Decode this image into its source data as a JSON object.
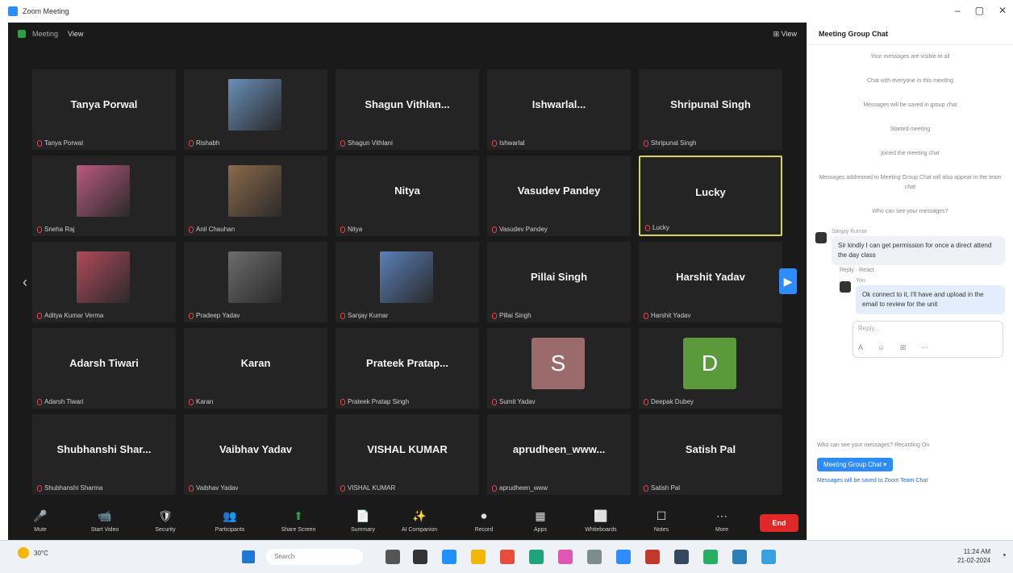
{
  "window": {
    "title": "Zoom Meeting",
    "controls": [
      "–",
      "▢",
      "✕"
    ]
  },
  "meeting_top": {
    "info": "View",
    "stat": "Meeting",
    "view_label": "⊞ View"
  },
  "tiles": [
    {
      "name": "Tanya Porwal",
      "label": "Tanya Porwal",
      "type": "name"
    },
    {
      "name": "",
      "label": "Rishabh",
      "type": "photo",
      "color": "#6a8fb8"
    },
    {
      "name": "Shagun Vithlan...",
      "label": "Shagun Vithlani",
      "type": "name"
    },
    {
      "name": "Ishwarlal...",
      "label": "Ishwarlal",
      "type": "name"
    },
    {
      "name": "Shripunal Singh",
      "label": "Shripunal Singh",
      "type": "name"
    },
    {
      "name": "",
      "label": "Sneha Raj",
      "type": "photo",
      "color": "#b95a7e"
    },
    {
      "name": "",
      "label": "Anil Chauhan",
      "type": "photo",
      "color": "#8a6a4a"
    },
    {
      "name": "Nitya",
      "label": "Nitya",
      "type": "name"
    },
    {
      "name": "Vasudev Pandey",
      "label": "Vasudev Pandey",
      "type": "name"
    },
    {
      "name": "Lucky",
      "label": "Lucky",
      "type": "name",
      "active": true
    },
    {
      "name": "",
      "label": "Aditya Kumar Verma",
      "type": "photo",
      "color": "#b04a5a"
    },
    {
      "name": "",
      "label": "Pradeep Yadav",
      "type": "photo",
      "color": "#6c6c6c"
    },
    {
      "name": "",
      "label": "Sanjay Kumar",
      "type": "photo",
      "color": "#5a7fb8"
    },
    {
      "name": "Pillai Singh",
      "label": "Pillai Singh",
      "type": "name"
    },
    {
      "name": "Harshit Yadav",
      "label": "Harshit Yadav",
      "type": "name"
    },
    {
      "name": "Adarsh Tiwari",
      "label": "Adarsh Tiwari",
      "type": "name"
    },
    {
      "name": "Karan",
      "label": "Karan",
      "type": "name"
    },
    {
      "name": "Prateek Pratap...",
      "label": "Prateek Pratap Singh",
      "type": "name"
    },
    {
      "name": "",
      "label": "Sumit Yadav",
      "type": "letter",
      "letter": "S",
      "color": "#9b6b6b"
    },
    {
      "name": "",
      "label": "Deepak Dubey",
      "type": "letter",
      "letter": "D",
      "color": "#5a9a3a"
    },
    {
      "name": "Shubhanshi Shar...",
      "label": "Shubhanshi Sharma",
      "type": "name"
    },
    {
      "name": "Vaibhav Yadav",
      "label": "Vaibhav Yadav",
      "type": "name"
    },
    {
      "name": "VISHAL KUMAR",
      "label": "VISHAL KUMAR",
      "type": "name"
    },
    {
      "name": "aprudheen_www...",
      "label": "aprudheen_www",
      "type": "name"
    },
    {
      "name": "Satish Pal",
      "label": "Satish Pal",
      "type": "name"
    }
  ],
  "toolbar": [
    {
      "icon": "🎤",
      "label": "Mute"
    },
    {
      "icon": "📹",
      "label": "Start Video"
    },
    {
      "icon": "🛡",
      "label": "Security"
    },
    {
      "icon": "👥",
      "label": "Participants"
    },
    {
      "icon": "⬆",
      "label": "Share Screen",
      "green": true
    },
    {
      "icon": "📄",
      "label": "Summary"
    },
    {
      "icon": "✨",
      "label": "AI Companion"
    },
    {
      "icon": "⏺",
      "label": "Record"
    },
    {
      "icon": "▦",
      "label": "Apps"
    },
    {
      "icon": "⬜",
      "label": "Whiteboards"
    },
    {
      "icon": "☐",
      "label": "Notes"
    },
    {
      "icon": "⋯",
      "label": "More"
    }
  ],
  "end_label": "End",
  "panel": {
    "title": "Meeting Group Chat",
    "system_messages": [
      "Your messages are visible to all",
      "Chat with everyone in this meeting",
      "Messages will be saved in group chat",
      "Started meeting",
      "joined the meeting chat",
      "Messages addressed to Meeting Group Chat will also appear in the team chat",
      "Who can see your messages?"
    ],
    "chat": [
      {
        "sender": "Sanjay Kumar",
        "text": "Sir kindly I can get permission for once a direct attend the day class"
      },
      {
        "sender": "You",
        "text": "Ok connect to it, I'll have and upload in the email to review for the unit",
        "reply": true
      }
    ],
    "reply_bar": "Reply  ·  React",
    "compose_placeholder": "Reply...",
    "compose_tools": "A ☺ ⊞ ⋯",
    "hint": "Who can see your messages? Recording On",
    "send_to": "Meeting Group Chat ▾",
    "note": "Messages will be saved to Zoom Team Chat"
  },
  "taskbar": {
    "weather": "30°C",
    "search": "Search",
    "time": "11:24 AM",
    "date": "21-02-2024"
  }
}
